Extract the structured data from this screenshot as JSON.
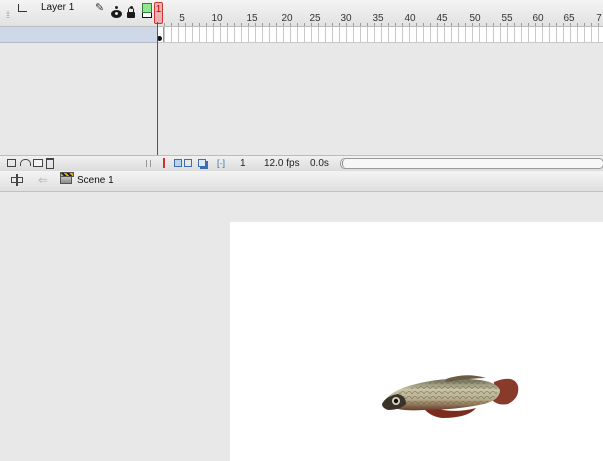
{
  "timeline": {
    "frame_numbers": [
      "5",
      "10",
      "15",
      "20",
      "25",
      "30",
      "35",
      "40",
      "45",
      "50",
      "55",
      "60",
      "65",
      "7"
    ],
    "current_frame_label": "1",
    "layers": [
      {
        "name": "Layer 1"
      }
    ],
    "footer": {
      "current_frame": "1",
      "frame_rate": "12.0 fps",
      "elapsed_time": "0.0s"
    }
  },
  "edit_bar": {
    "scene_name": "Scene 1"
  },
  "colors": {
    "playhead": "#cc3333",
    "layer_selected": "#cfd8e8",
    "outline_swatch": "#8ee88e",
    "stage": "#ffffff",
    "workspace": "#e8e8e8"
  },
  "icons": [
    "eye-icon",
    "lock-icon",
    "outline-icon",
    "layer-icon",
    "pencil-icon",
    "new-layer-icon",
    "motion-guide-icon",
    "new-folder-icon",
    "delete-icon",
    "onion-skin-icon",
    "timeline-toggle-icon",
    "back-arrow-icon",
    "scene-icon"
  ]
}
